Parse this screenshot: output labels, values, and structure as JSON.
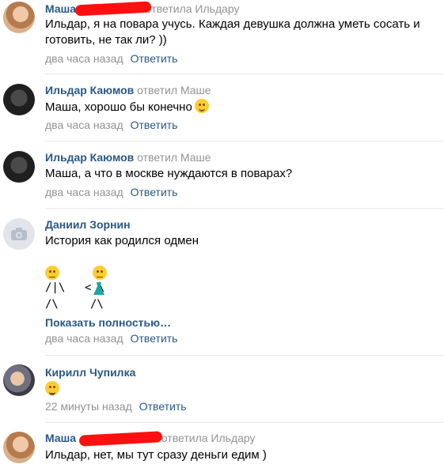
{
  "comments": [
    {
      "author": "Маша",
      "reply_to": "ответила Ильдару",
      "text_lines": [
        "Ильдар, я на повара учусь. Каждая девушка должна уметь сосать и",
        "готовить, не так ли? ))"
      ],
      "time": "два часа назад",
      "reply_label": "Ответить"
    },
    {
      "author": "Ильдар Каюмов",
      "reply_to": "ответил Маше",
      "text_lines": [
        "Маша, хорошо бы конечно"
      ],
      "time": "два часа назад",
      "reply_label": "Ответить"
    },
    {
      "author": "Ильдар Каюмов",
      "reply_to": "ответил Маше",
      "text_lines": [
        "Маша, а что в москве нуждаются в поварах?"
      ],
      "time": "два часа назад",
      "reply_label": "Ответить"
    },
    {
      "author": "Даниил Зорнин",
      "reply_to": "",
      "text_lines": [
        "История как родился одмен"
      ],
      "art_left": [
        "/|\\",
        " /\\"
      ],
      "art_right": [
        "<  \\",
        " /\\"
      ],
      "show_more": "Показать полностью…",
      "time": "два часа назад",
      "reply_label": "Ответить"
    },
    {
      "author": "Кирилл Чупилка",
      "reply_to": "",
      "text_lines": [
        ""
      ],
      "time": "22 минуты назад",
      "reply_label": "Ответить"
    },
    {
      "author": "Маша",
      "reply_to": "ответила Ильдару",
      "text_lines": [
        "Ильдар, нет, мы тут сразу деньги едим )"
      ],
      "time": "",
      "reply_label": ""
    }
  ],
  "colors": {
    "link": "#2a5885",
    "muted": "#939393",
    "separator": "#e7e8ec",
    "redaction": "#ff1010"
  }
}
